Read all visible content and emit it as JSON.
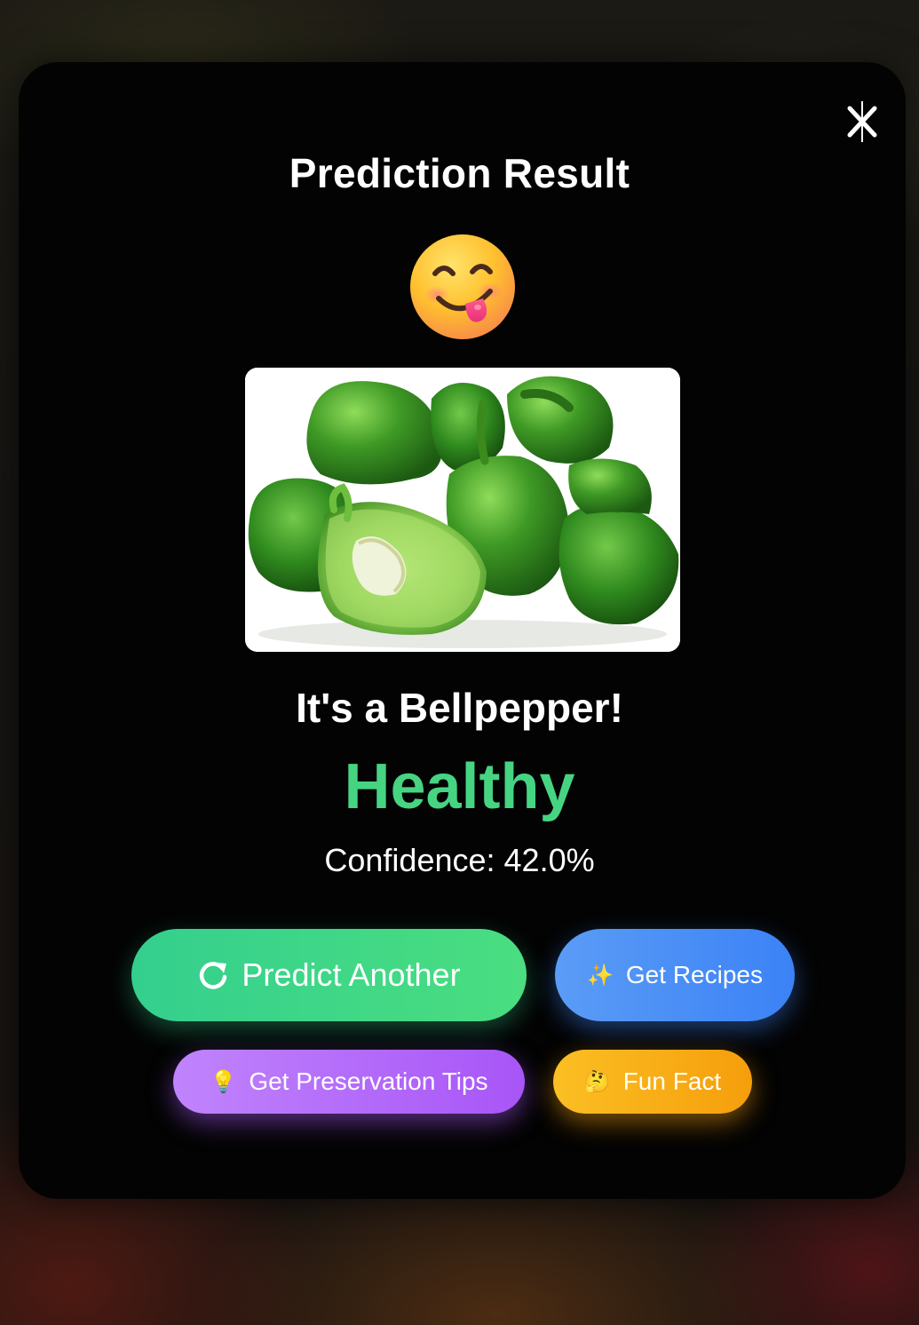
{
  "modal": {
    "title": "Prediction Result",
    "close_icon": "close-icon",
    "emoji": "face-savoring-food-emoji",
    "image_subject": "green bell peppers",
    "result_text": "It's a Bellpepper!",
    "status": "Healthy",
    "confidence_text": "Confidence: 42.0%",
    "confidence_value": 42.0
  },
  "actions": {
    "predict_label": "Predict Another",
    "recipes_emoji": "✨",
    "recipes_label": "Get Recipes",
    "tips_emoji": "💡",
    "tips_label": "Get Preservation Tips",
    "fact_emoji": "🤔",
    "fact_label": "Fun Fact"
  },
  "colors": {
    "status_green": "#46d483",
    "predict_button": "#3ed486",
    "recipes_button": "#4b8ff6",
    "tips_button": "#b66cf9",
    "fact_button": "#f8ae18",
    "modal_background": "#030303"
  }
}
